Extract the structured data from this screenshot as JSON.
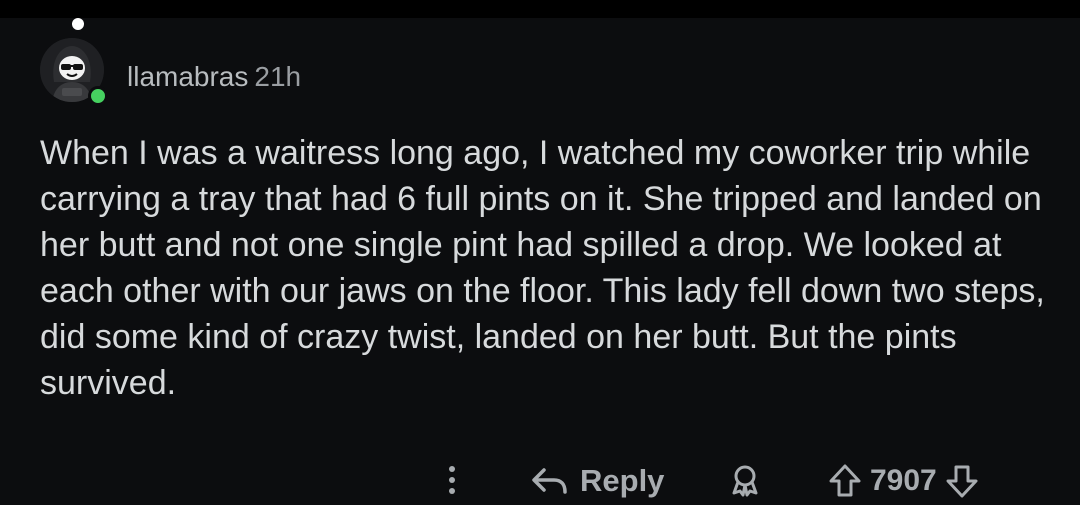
{
  "comment": {
    "author": "llamabras",
    "age": "21h",
    "body": "When I was a waitress long ago, I watched my coworker trip while carrying a tray that had 6 full pints on it. She tripped and landed on her butt and not one single pint had spilled a drop. We looked at each other with our jaws on the floor. This lady fell down two steps, did some kind of crazy twist, landed on her butt. But the pints survived."
  },
  "actions": {
    "more_icon": "more-vertical-icon",
    "reply_label": "Reply",
    "reply_icon": "reply-arrow-icon",
    "award_icon": "award-icon",
    "upvote_icon": "arrow-up-icon",
    "score": "7907",
    "downvote_icon": "arrow-down-icon"
  },
  "colors": {
    "background": "#0c0d0f",
    "text": "#d7dadc",
    "muted": "#a8acb0",
    "online": "#46d160"
  }
}
